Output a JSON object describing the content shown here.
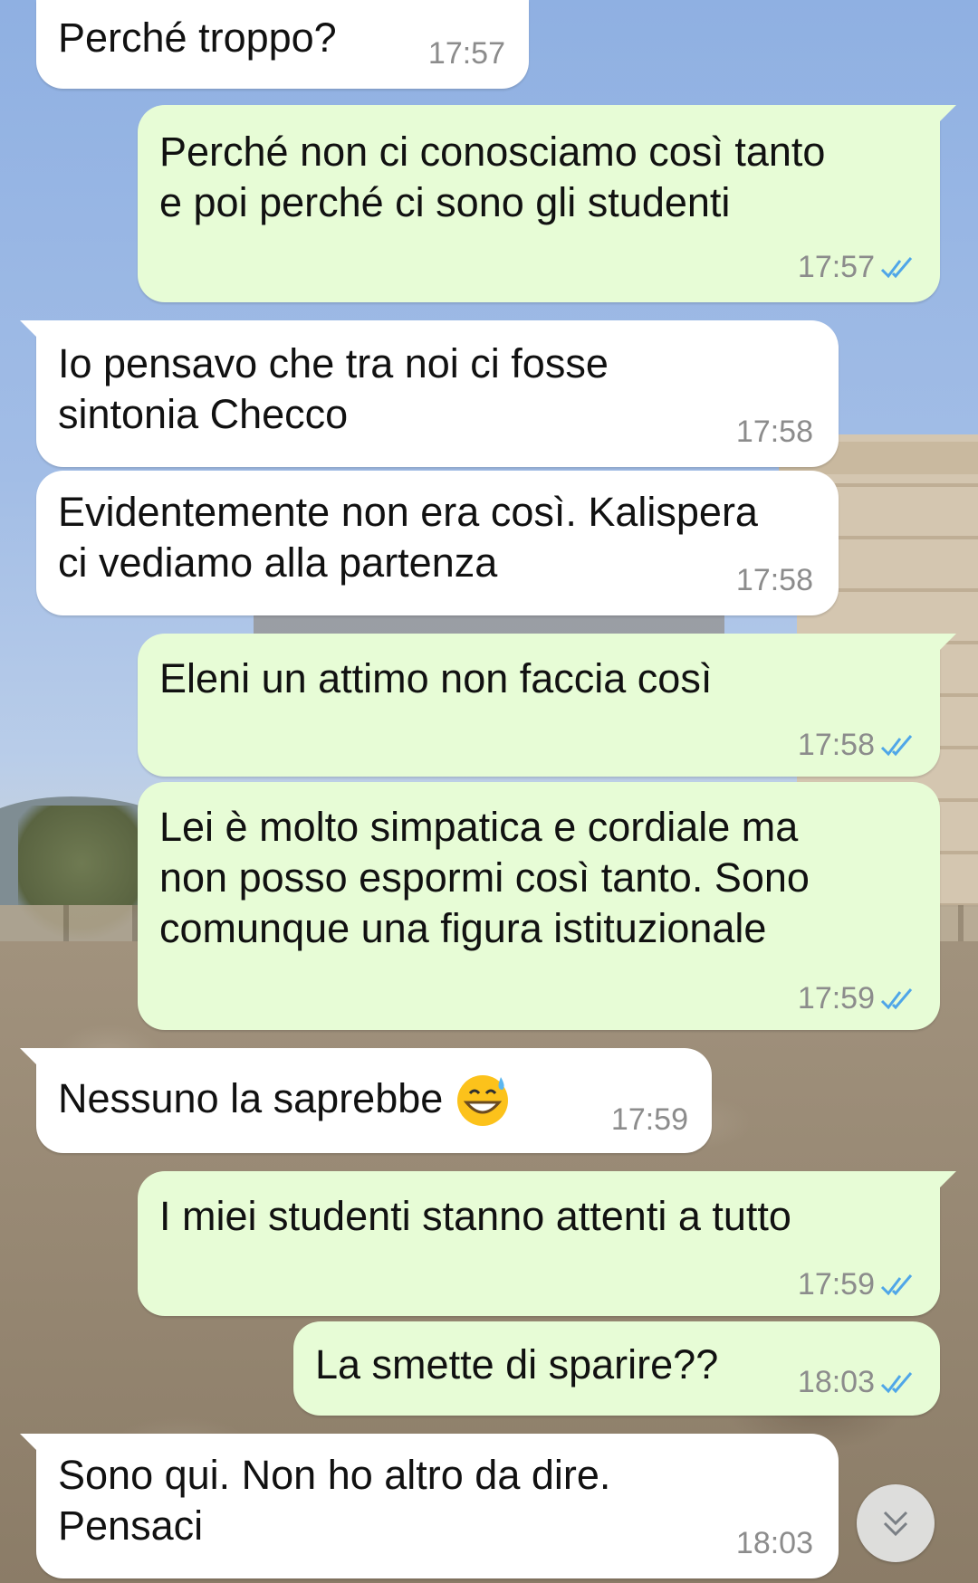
{
  "messages": [
    {
      "dir": "in",
      "text": "Perché troppo?",
      "time": "17:57"
    },
    {
      "dir": "out",
      "text": "Perché non ci conosciamo così tanto\ne poi perché ci sono gli studenti",
      "time": "17:57",
      "status": "read"
    },
    {
      "dir": "in",
      "text": "Io pensavo che tra noi ci fosse\nsintonia Checco",
      "time": "17:58"
    },
    {
      "dir": "in",
      "text": "Evidentemente non era così. Kalispera\nci vediamo alla partenza",
      "time": "17:58"
    },
    {
      "dir": "out",
      "text": "Eleni un attimo non faccia così",
      "time": "17:58",
      "status": "read"
    },
    {
      "dir": "out",
      "text": "Lei è molto simpatica e cordiale ma\nnon posso espormi così tanto. Sono\ncomunque una figura istituzionale",
      "time": "17:59",
      "status": "read"
    },
    {
      "dir": "in",
      "text": "Nessuno la saprebbe",
      "emoji": "grinning-face-with-sweat-icon",
      "time": "17:59"
    },
    {
      "dir": "out",
      "text": "I miei studenti stanno attenti a tutto",
      "time": "17:59",
      "status": "read"
    },
    {
      "dir": "out",
      "text": "La smette di sparire??",
      "time": "18:03",
      "status": "read"
    },
    {
      "dir": "in",
      "text": "Sono qui. Non ho altro da dire.\nPensaci",
      "time": "18:03"
    }
  ],
  "colors": {
    "incoming_bubble": "#ffffff",
    "outgoing_bubble": "#e7fcd6",
    "read_ticks": "#4fa6e8",
    "time_text": "#8c8c8c"
  },
  "scroll_button": {
    "icon": "double-chevron-down-icon"
  }
}
